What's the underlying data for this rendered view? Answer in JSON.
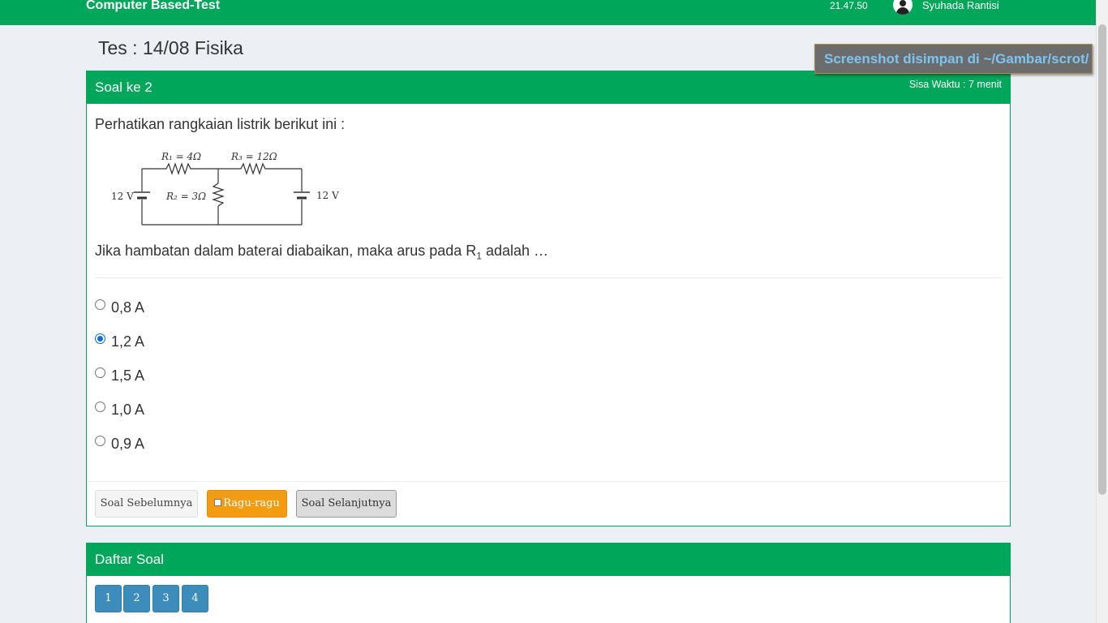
{
  "header": {
    "brand": "Computer Based-Test",
    "clock": "21.47.50",
    "user_name": "Syuhada Rantisi"
  },
  "notification": {
    "text": "Screenshot disimpan di ~/Gambar/scrot/"
  },
  "page": {
    "title": "Tes : 14/08 Fisika"
  },
  "question_panel": {
    "heading": "Soal ke 2",
    "timer": "Sisa Waktu : 7 menit",
    "intro": "Perhatikan rangkaian listrik berikut ini :",
    "circuit": {
      "r1": "R₁ = 4Ω",
      "r2": "R₂ = 3Ω",
      "r3": "R₃ = 12Ω",
      "battery_left": "12 V",
      "battery_right": "12 V"
    },
    "question_before": "Jika hambatan dalam baterai diabaikan, maka arus pada R",
    "question_sub": "1",
    "question_after": " adalah …",
    "options": [
      {
        "label": "0,8 A",
        "selected": false
      },
      {
        "label": "1,2 A",
        "selected": true
      },
      {
        "label": "1,5 A",
        "selected": false
      },
      {
        "label": "1,0 A",
        "selected": false
      },
      {
        "label": "0,9 A",
        "selected": false
      }
    ],
    "buttons": {
      "prev": "Soal Sebelumnya",
      "doubt": "Ragu-ragu",
      "next": "Soal Selanjutnya"
    }
  },
  "question_list": {
    "heading": "Daftar Soal",
    "numbers": [
      "1",
      "2",
      "3",
      "4"
    ]
  },
  "colors": {
    "primary_green": "#00a65a",
    "number_blue": "#3c8dbc",
    "doubt_orange": "#f39c12",
    "toast_text": "#7ec4f0"
  }
}
